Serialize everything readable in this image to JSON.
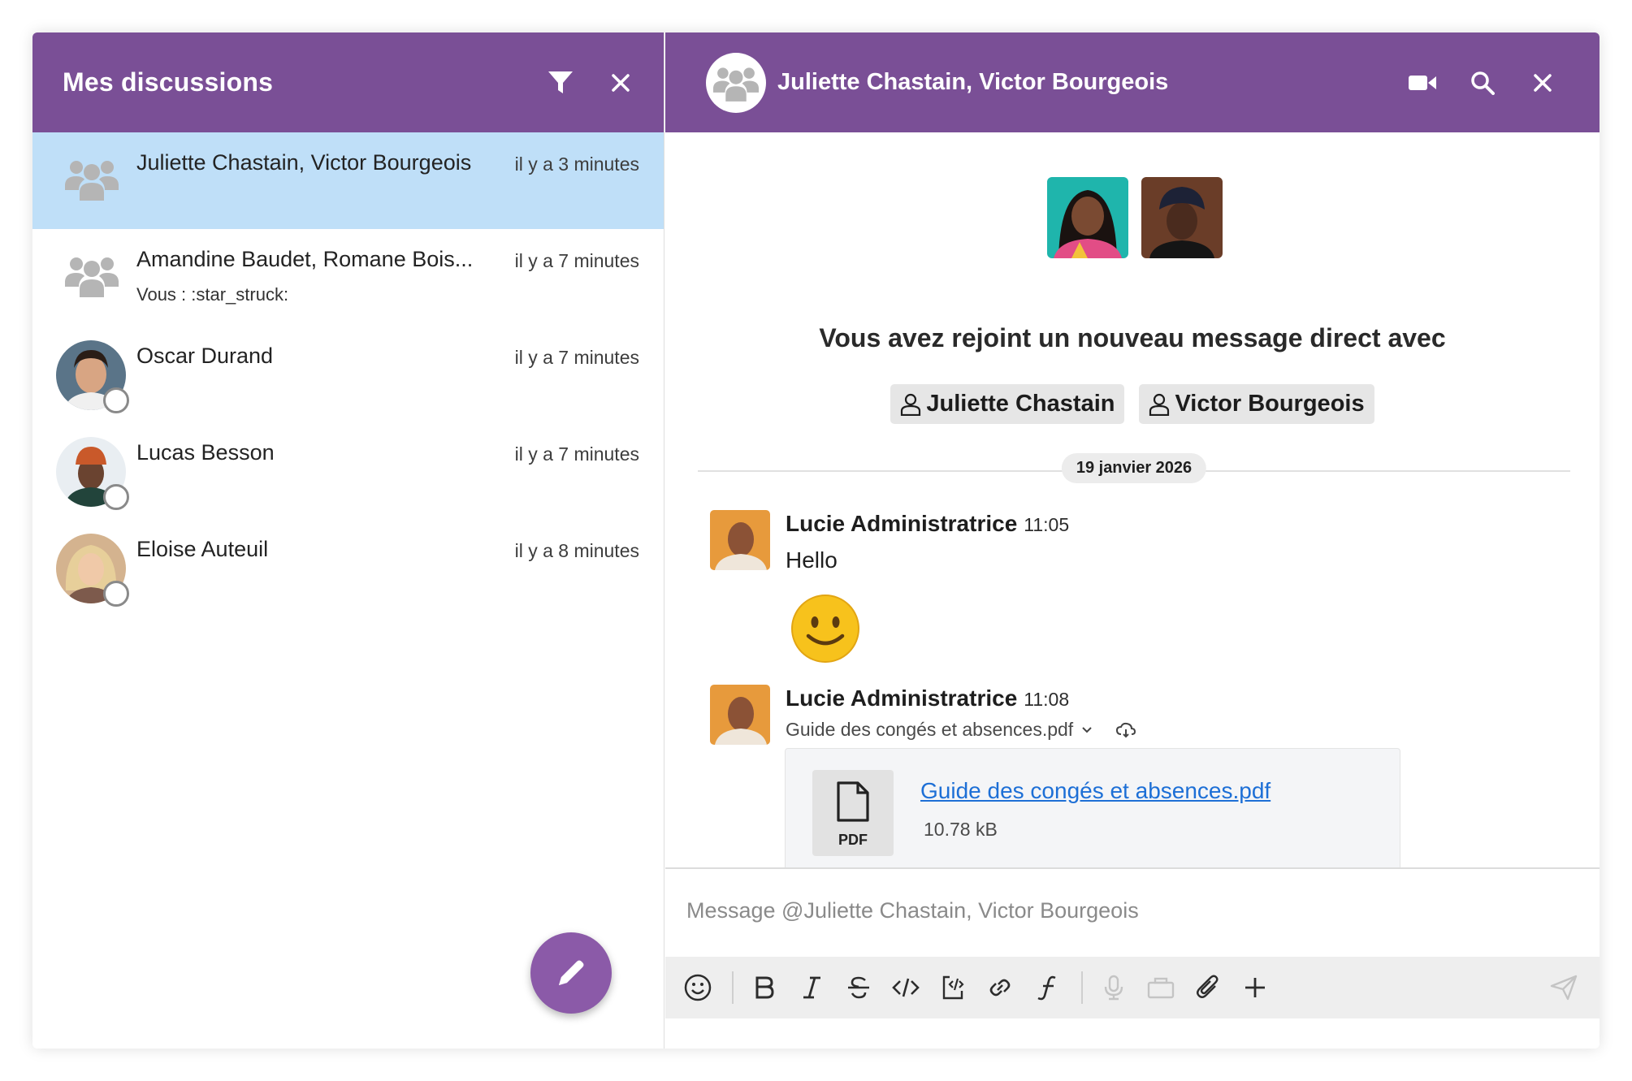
{
  "sidebar": {
    "title": "Mes discussions",
    "conversations": [
      {
        "name": "Juliette Chastain, Victor Bourgeois",
        "time": "il y a 3 minutes",
        "preview": "",
        "type": "group"
      },
      {
        "name": "Amandine Baudet, Romane Bois...",
        "time": "il y a 7 minutes",
        "preview": "Vous : :star_struck:",
        "type": "group"
      },
      {
        "name": "Oscar Durand",
        "time": "il y a 7 minutes",
        "preview": "",
        "type": "user"
      },
      {
        "name": "Lucas Besson",
        "time": "il y a 7 minutes",
        "preview": "",
        "type": "user"
      },
      {
        "name": "Eloise Auteuil",
        "time": "il y a 8 minutes",
        "preview": "",
        "type": "user"
      }
    ]
  },
  "channel": {
    "title": "Juliette Chastain, Victor Bourgeois",
    "intro": "Vous avez rejoint un nouveau message direct avec",
    "mentions": [
      "Juliette Chastain",
      "Victor Bourgeois"
    ],
    "date": "19 janvier 2026"
  },
  "messages": [
    {
      "author": "Lucie Administratrice",
      "time": "11:05",
      "text": "Hello",
      "emoji": "🙂"
    },
    {
      "author": "Lucie Administratrice",
      "time": "11:08",
      "attachment_title": "Guide des congés et absences.pdf",
      "file": {
        "name": "Guide des congés et absences.pdf",
        "size": "10.78 kB",
        "type_label": "PDF"
      }
    }
  ],
  "composer": {
    "placeholder": "Message @Juliette Chastain, Victor Bourgeois"
  },
  "colors": {
    "header": "#7a4f96",
    "active_row": "#bfdff8",
    "fab": "#8b5aa8",
    "link": "#1d6fd6"
  }
}
